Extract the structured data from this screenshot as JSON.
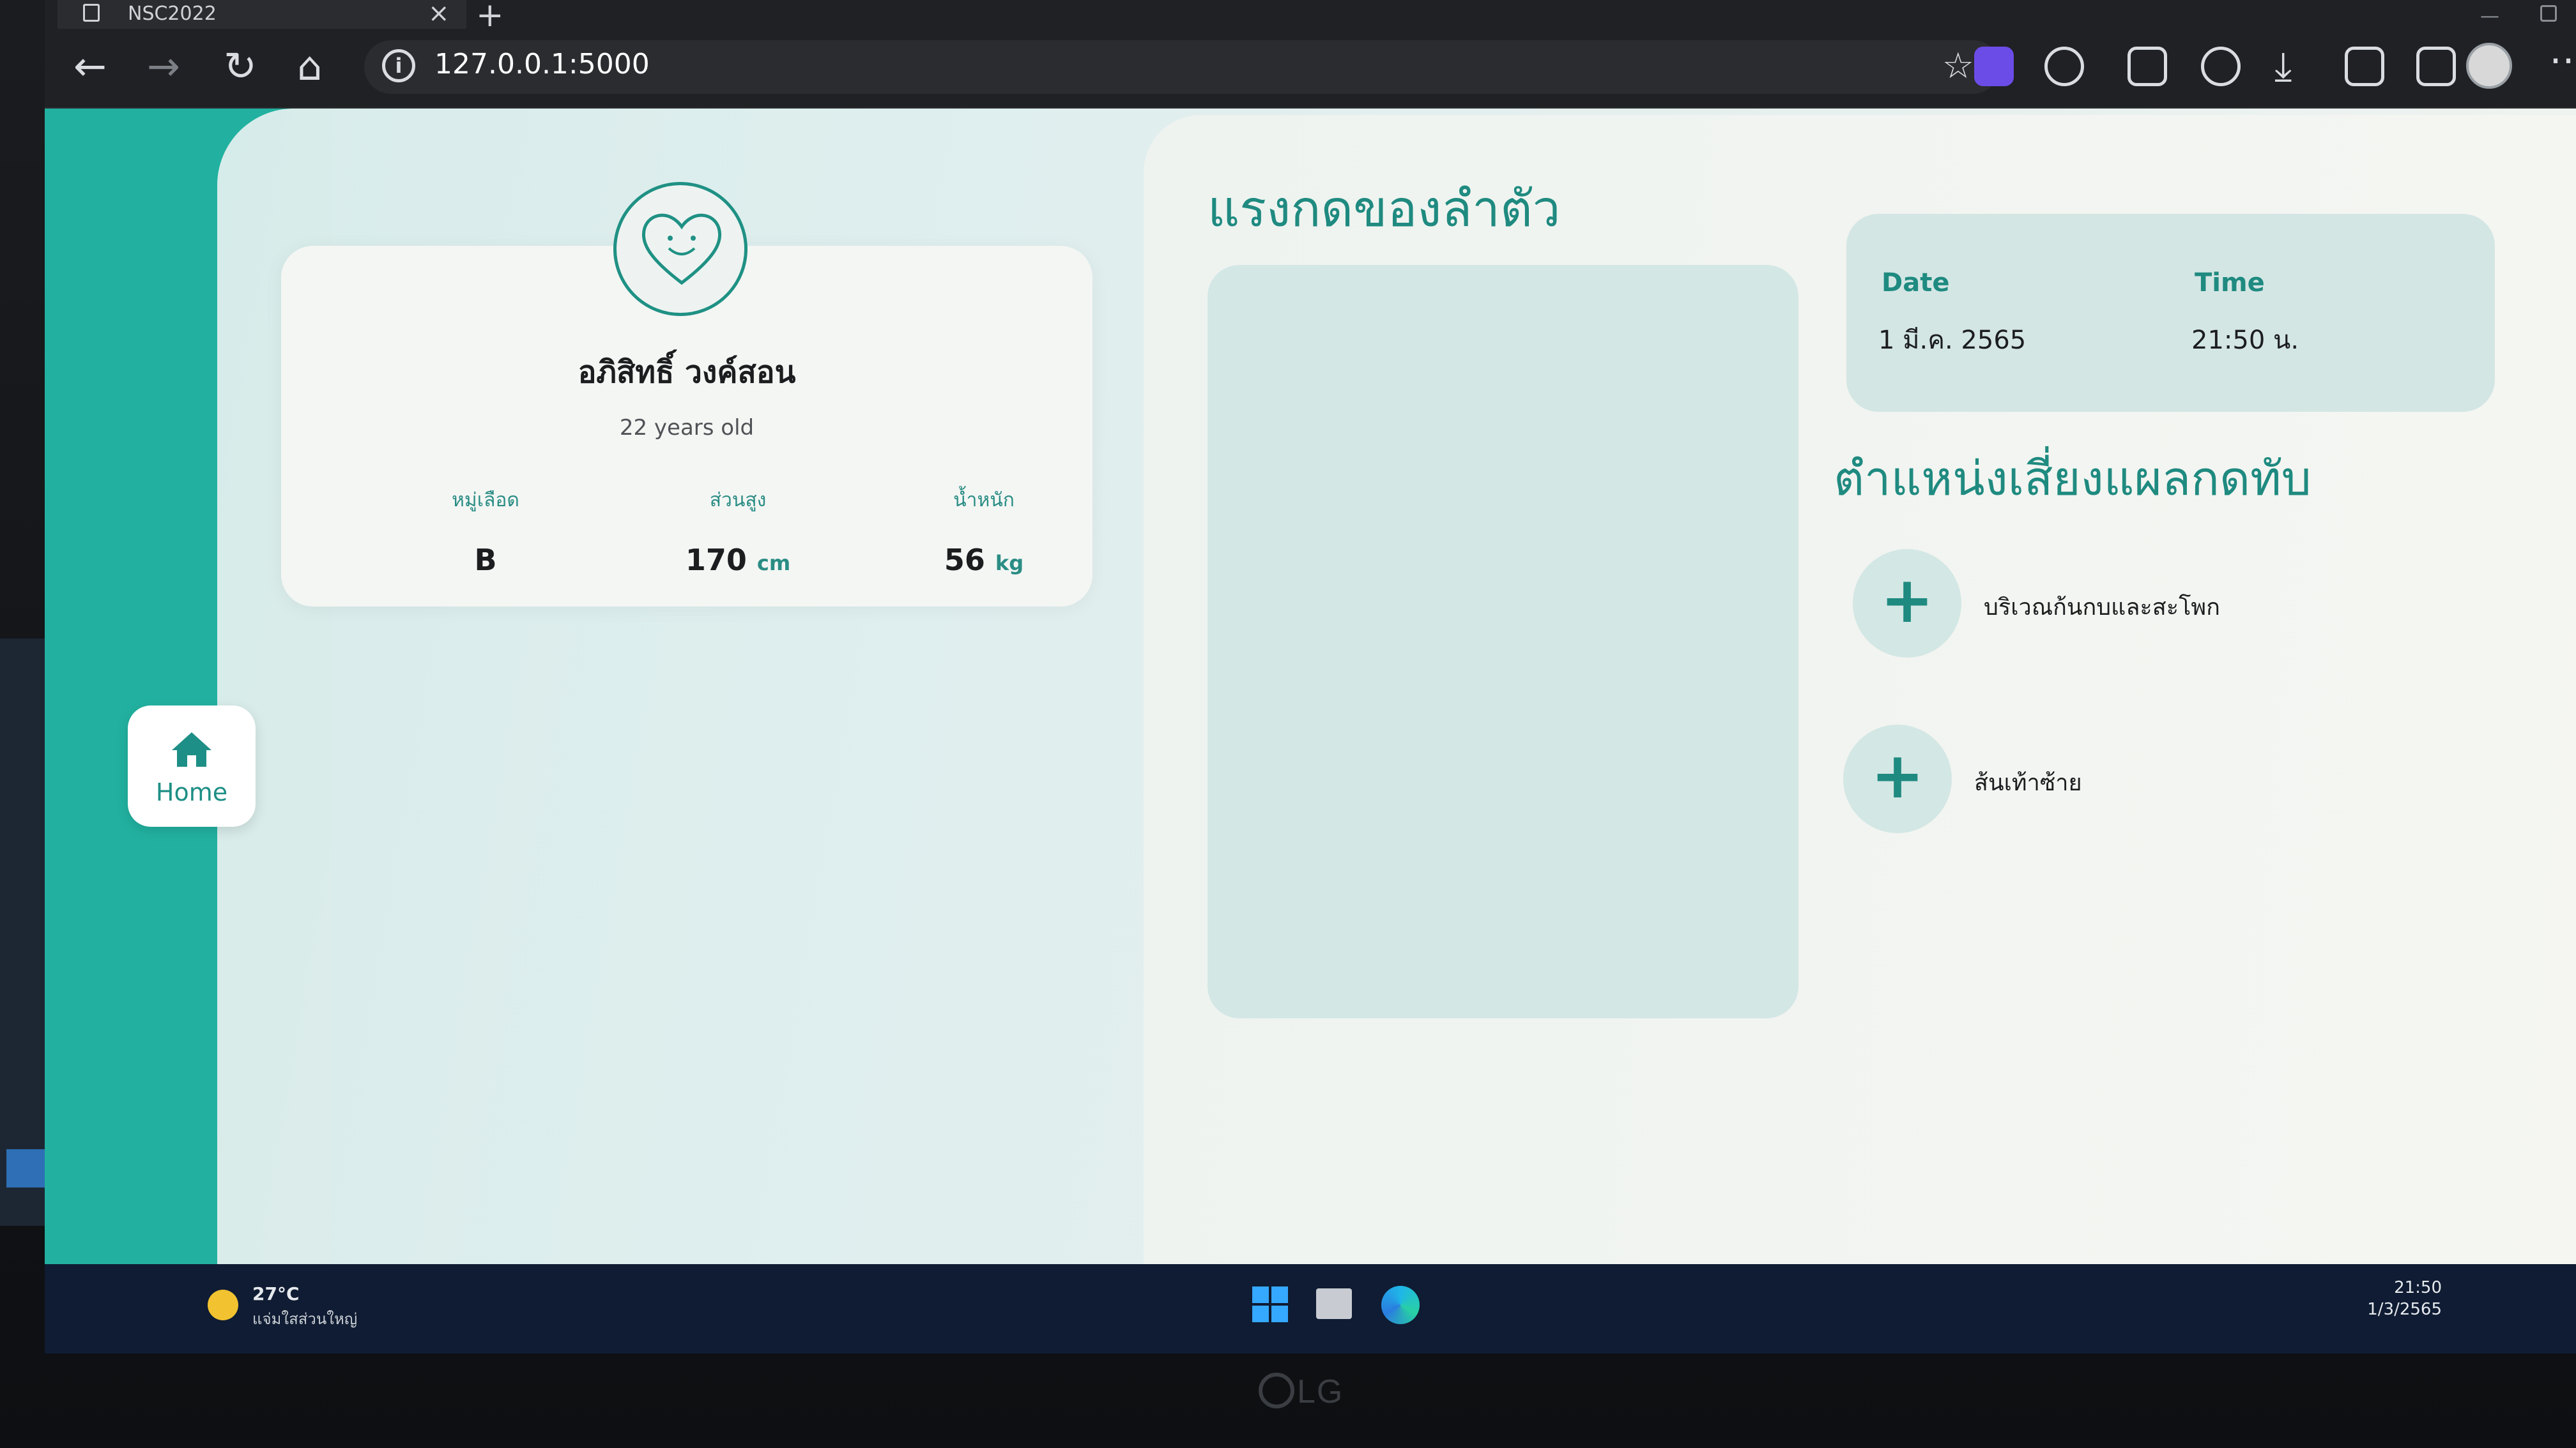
{
  "browser": {
    "tab_title": "NSC2022",
    "url": "127.0.0.1:5000"
  },
  "sidebar": {
    "home_label": "Home"
  },
  "profile": {
    "name": "อภิสิทธิ์ วงค์สอน",
    "age": "22 years old",
    "stats": [
      {
        "label": "หมู่เลือด",
        "value": "B",
        "unit": ""
      },
      {
        "label": "ส่วนสูง",
        "value": "170",
        "unit": "cm"
      },
      {
        "label": "น้ำหนัก",
        "value": "56",
        "unit": "kg"
      }
    ]
  },
  "pressure": {
    "title": "แรงกดของลำตัว"
  },
  "datetime": {
    "date_label": "Date",
    "time_label": "Time",
    "date_value": "1 มี.ค. 2565",
    "time_value": "21:50 น."
  },
  "risk": {
    "title": "ตำแหน่งเสี่ยงแผลกดทับ",
    "items": [
      {
        "label": "บริเวณก้นกบและสะโพก"
      },
      {
        "label": "ส้นเท้าซ้าย"
      }
    ]
  },
  "taskbar": {
    "temperature": "27°C",
    "weather_desc": "แจ่มใสส่วนใหญ่",
    "clock_time": "21:50",
    "clock_date": "1/3/2565"
  },
  "monitor": {
    "brand": "LG"
  },
  "colors": {
    "accent": "#22b1a0",
    "accent_text": "#1f8a80"
  }
}
